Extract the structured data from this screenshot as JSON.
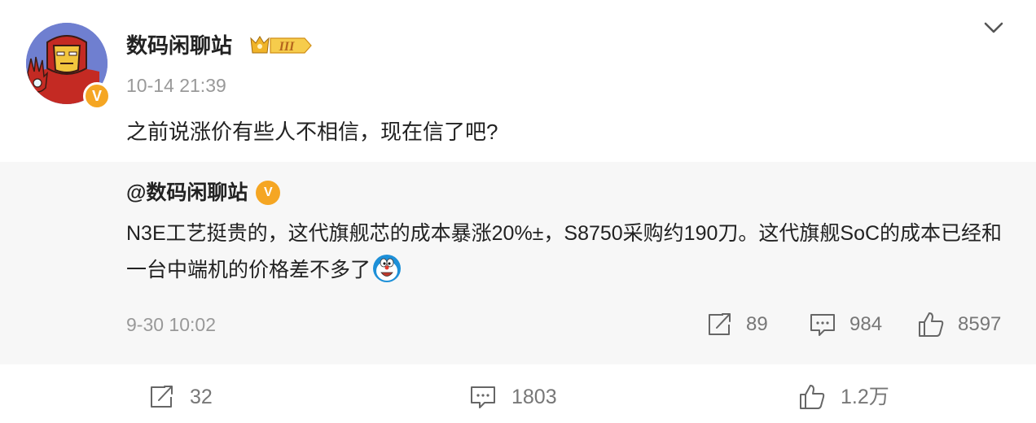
{
  "post": {
    "author": "数码闲聊站",
    "level_badge": "III",
    "time": "10-14 21:39",
    "text": "之前说涨价有些人不相信，现在信了吧?",
    "stats": {
      "reposts": "32",
      "comments": "1803",
      "likes": "1.2万"
    }
  },
  "repost": {
    "author": "@数码闲聊站",
    "text": "N3E工艺挺贵的，这代旗舰芯的成本暴涨20%±，S8750采购约190刀。这代旗舰SoC的成本已经和一台中端机的价格差不多了",
    "emoji": "doraemon-emoji",
    "time": "9-30 10:02",
    "stats": {
      "reposts": "89",
      "comments": "984",
      "likes": "8597"
    }
  },
  "icons": {
    "verified": "V",
    "menu": "chevron-down-icon",
    "repost": "repost-icon",
    "comment": "comment-icon",
    "like": "like-icon"
  },
  "colors": {
    "verified": "#f5a623",
    "muted": "#999999",
    "repost_bg": "#f7f7f7"
  }
}
